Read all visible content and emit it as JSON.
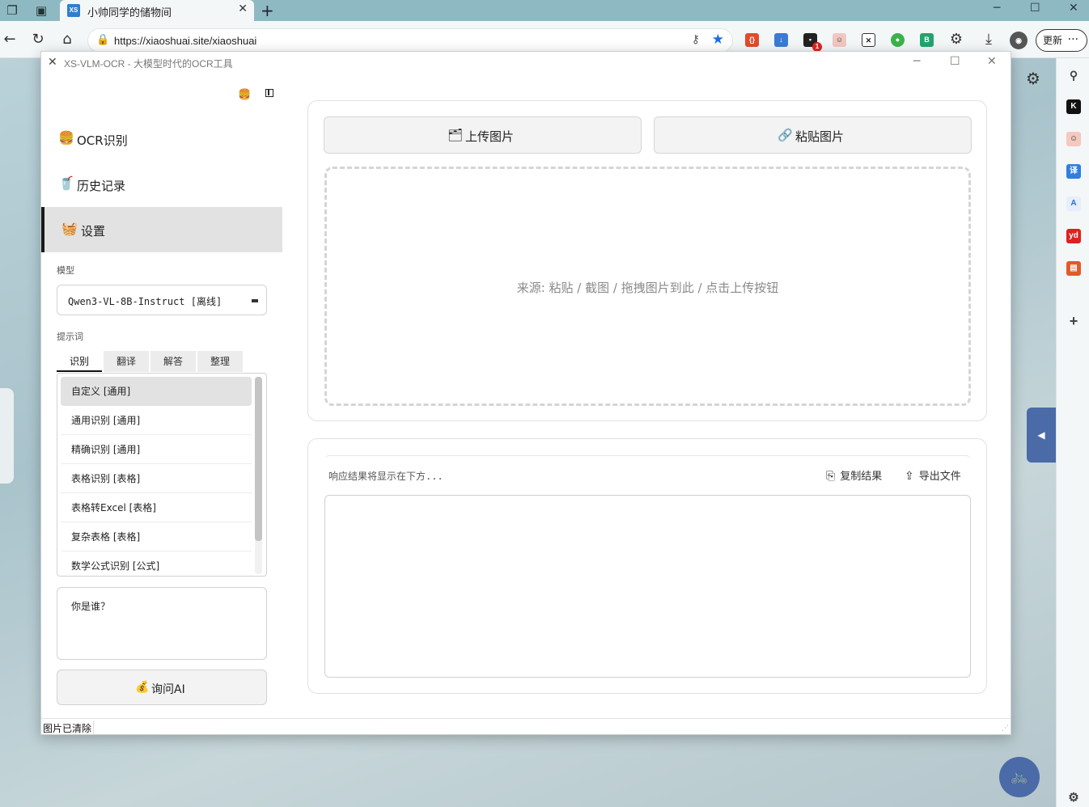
{
  "browser": {
    "tab_title": "小帅同学的储物间",
    "tab_favicon": "XS",
    "url": "https://xiaoshuai.site/xiaoshuai",
    "update_label": "更新",
    "ext_badge": "1"
  },
  "app": {
    "window_title": "XS-VLM-OCR - 大模型时代的OCR工具",
    "nav": [
      {
        "icon": "🍔",
        "label": "OCR识别"
      },
      {
        "icon": "🥤",
        "label": "历史记录"
      },
      {
        "icon": "🧺",
        "label": "设置"
      }
    ],
    "model_label": "模型",
    "model_value": "Qwen3-VL-8B-Instruct [离线]",
    "prompt_label": "提示词",
    "prompt_tabs": [
      "识别",
      "翻译",
      "解答",
      "整理"
    ],
    "prompt_items": [
      "自定义 [通用]",
      "通用识别 [通用]",
      "精确识别 [通用]",
      "表格识别 [表格]",
      "表格转Excel [表格]",
      "复杂表格 [表格]",
      "数学公式识别 [公式]"
    ],
    "question_text": "你是谁？",
    "ask_label": "询问AI",
    "upload_label": "上传图片",
    "paste_label": "粘贴图片",
    "drop_hint": "来源: 粘贴 / 截图 / 拖拽图片到此 / 点击上传按钮",
    "result_placeholder": "响应结果将显示在下方...",
    "copy_label": "复制结果",
    "export_label": "导出文件",
    "status_text": "图片已清除"
  },
  "colors": {
    "accent_blue": "#4b6aa8",
    "active_nav_bg": "#e2e2e2"
  }
}
